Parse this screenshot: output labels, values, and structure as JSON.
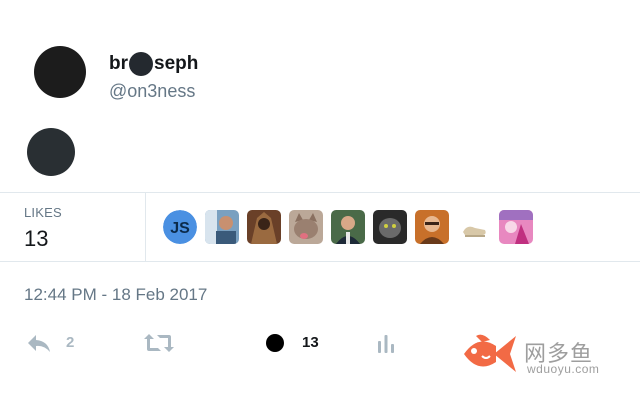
{
  "tweet": {
    "author_name_prefix": "br",
    "author_name_suffix": "seph",
    "handle": "@on3ness",
    "timestamp": "12:44 PM - 18 Feb 2017"
  },
  "stats": {
    "likes_label": "LIKES",
    "likes_count": "13"
  },
  "likers": [
    {
      "name": "js-avatar",
      "text": "JS",
      "color": "#4a90e2"
    },
    {
      "name": "person-2",
      "color": "#5a7fa0"
    },
    {
      "name": "person-3",
      "color": "#8a5a3a"
    },
    {
      "name": "cat-4",
      "color": "#a89080"
    },
    {
      "name": "person-5",
      "color": "#3d5a3a"
    },
    {
      "name": "cat-6",
      "color": "#3a3a3a"
    },
    {
      "name": "person-7",
      "color": "#b86a2a"
    },
    {
      "name": "shoe-8",
      "color": "#d8c8a8"
    },
    {
      "name": "art-9",
      "color": "#d860a0"
    }
  ],
  "actions": {
    "reply_count": "2",
    "like_count": "13"
  },
  "watermark": {
    "chinese": "网多鱼",
    "url": "wduoyu.com"
  },
  "colors": {
    "muted": "#657786",
    "border": "#e1e8ed",
    "icon": "#aab8c2",
    "watermark_fish": "#f26a45"
  }
}
